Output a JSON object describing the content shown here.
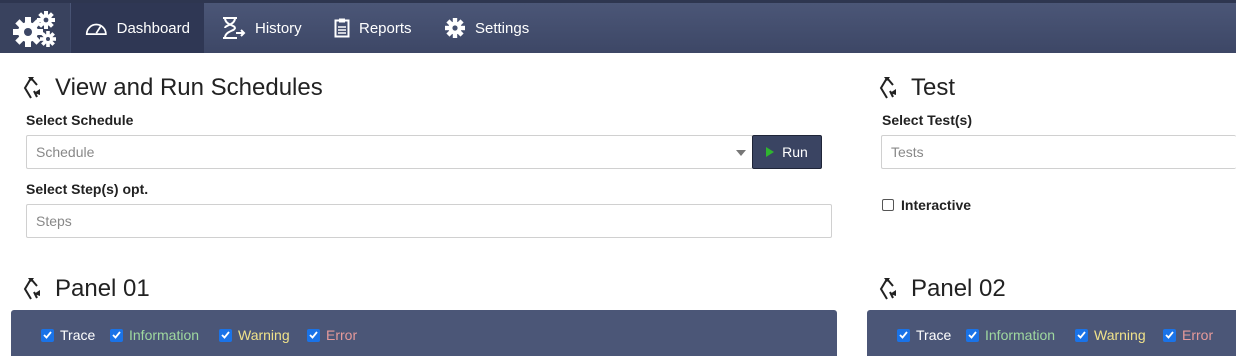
{
  "nav": {
    "items": [
      {
        "label": "Dashboard",
        "icon": "gauge-icon",
        "active": true
      },
      {
        "label": "History",
        "icon": "hourglass-icon"
      },
      {
        "label": "Reports",
        "icon": "clipboard-icon"
      },
      {
        "label": "Settings",
        "icon": "gear-icon"
      }
    ]
  },
  "schedules": {
    "title": "View and Run Schedules",
    "schedule_label": "Select Schedule",
    "schedule_placeholder": "Schedule",
    "run_label": "Run",
    "steps_label": "Select Step(s) opt.",
    "steps_placeholder": "Steps"
  },
  "test": {
    "title": "Test",
    "tests_label": "Select Test(s)",
    "tests_placeholder": "Tests",
    "interactive_label": "Interactive",
    "interactive_checked": false
  },
  "panel01": {
    "title": "Panel 01",
    "filters": [
      {
        "label": "Trace",
        "checked": true,
        "color": "#ffffff"
      },
      {
        "label": "Information",
        "checked": true,
        "color": "#9fd89f"
      },
      {
        "label": "Warning",
        "checked": true,
        "color": "#f0e28a"
      },
      {
        "label": "Error",
        "checked": true,
        "color": "#e69a9a"
      }
    ]
  },
  "panel02": {
    "title": "Panel 02",
    "filters": [
      {
        "label": "Trace",
        "checked": true,
        "color": "#ffffff"
      },
      {
        "label": "Information",
        "checked": true,
        "color": "#9fd89f"
      },
      {
        "label": "Warning",
        "checked": true,
        "color": "#f0e28a"
      },
      {
        "label": "Error",
        "checked": true,
        "color": "#e69a9a"
      }
    ]
  }
}
